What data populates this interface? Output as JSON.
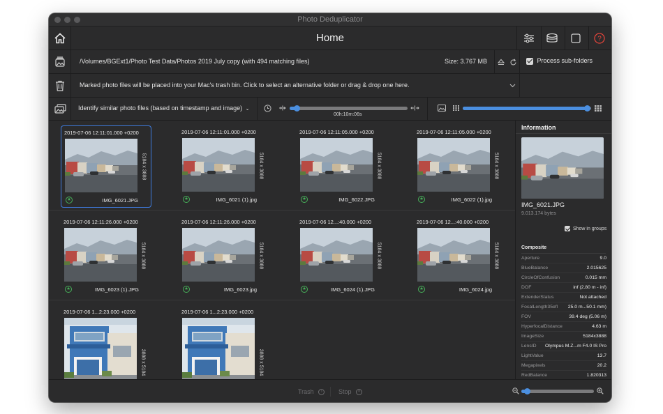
{
  "window": {
    "title": "Photo Deduplicator"
  },
  "header": {
    "title": "Home"
  },
  "folder": {
    "path": "/Volumes/BGExt1/Photo Test Data/Photos 2019 July copy (with 494 matching files)",
    "size": "Size: 3.767 MB",
    "subfolders_label": "Process sub-folders",
    "subfolders_checked": true
  },
  "trash": {
    "message": "Marked photo files will be placed into your Mac's trash bin.  Click to select an alternative folder or drag & drop one here."
  },
  "mode": {
    "selected": "Identify similar photo files (based on timestamp and image)",
    "time_threshold": "00h:10m:06s",
    "time_fraction": 0.06,
    "similarity_fraction": 0.97
  },
  "photos": [
    {
      "timestamp": "2019-07-06 12:11:01.000 +0200",
      "dimensions": "5184 x 3888",
      "filename": "IMG_6021.JPG",
      "selected": true
    },
    {
      "timestamp": "2019-07-06 12:11:01.000 +0200",
      "dimensions": "5184 x 3888",
      "filename": "IMG_6021 (1).jpg"
    },
    {
      "timestamp": "2019-07-06 12:11:05.000 +0200",
      "dimensions": "5184 x 3888",
      "filename": "IMG_6022.JPG"
    },
    {
      "timestamp": "2019-07-06 12:11:05.000 +0200",
      "dimensions": "5184 x 3888",
      "filename": "IMG_6022 (1).jpg"
    },
    {
      "timestamp": "2019-07-06 12:11:26.000 +0200",
      "dimensions": "5184 x 3888",
      "filename": "IMG_6023 (1).JPG"
    },
    {
      "timestamp": "2019-07-06 12:11:26.000 +0200",
      "dimensions": "5184 x 3888",
      "filename": "IMG_6023.jpg"
    },
    {
      "timestamp": "2019-07-06 12...:40.000 +0200",
      "dimensions": "5184 x 3888",
      "filename": "IMG_6024 (1).JPG"
    },
    {
      "timestamp": "2019-07-06 12...:40.000 +0200",
      "dimensions": "5184 x 3888",
      "filename": "IMG_6024.jpg"
    },
    {
      "timestamp": "2019-07-06 1...2:23.000 +0200",
      "dimensions": "3888 x 5184",
      "filename": ""
    },
    {
      "timestamp": "2019-07-06 1...2:23.000 +0200",
      "dimensions": "3888 x 5184",
      "filename": ""
    }
  ],
  "info": {
    "title": "Information",
    "filename": "IMG_6021.JPG",
    "filesize": "9.013.174 bytes",
    "show_groups_label": "Show in groups",
    "section": "Composite",
    "rows": [
      {
        "key": "Aperture",
        "value": "9.0"
      },
      {
        "key": "BlueBalance",
        "value": "2.015625"
      },
      {
        "key": "CircleOfConfusion",
        "value": "0.015 mm"
      },
      {
        "key": "DOF",
        "value": "inf (2.80 m - inf)"
      },
      {
        "key": "ExtenderStatus",
        "value": "Not attached"
      },
      {
        "key": "FocalLength35efl",
        "value": "25.0 m...50.1 mm)"
      },
      {
        "key": "FOV",
        "value": "39.4 deg (5.06 m)"
      },
      {
        "key": "HyperfocalDistance",
        "value": "4.63 m"
      },
      {
        "key": "ImageSize",
        "value": "5184x3888"
      },
      {
        "key": "LensID",
        "value": "Olympus M.Z...m F4.0 IS Pro"
      },
      {
        "key": "LightValue",
        "value": "13.7"
      },
      {
        "key": "Megapixels",
        "value": "20.2"
      },
      {
        "key": "RedBalance",
        "value": "1.820313"
      }
    ]
  },
  "bottom": {
    "trash_label": "Trash",
    "stop_label": "Stop",
    "zoom_fraction": 0.08
  },
  "colors": {
    "accent": "#4b8fe0",
    "star": "#47b25a",
    "help": "#e0443a",
    "background": "#2b2b2c"
  }
}
